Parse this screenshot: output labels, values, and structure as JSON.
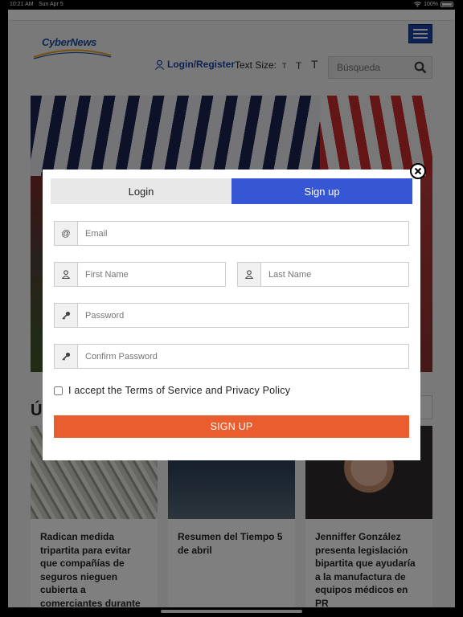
{
  "status_bar": {
    "time": "10:21 AM",
    "date": "Sun Apr 5",
    "battery": "100%"
  },
  "header": {
    "logo_text": "CyberNews",
    "login_label": "Login/Register",
    "text_size_label": "Text Size:",
    "text_size_options": [
      "T",
      "T",
      "T"
    ],
    "search_placeholder": "Búsqueda"
  },
  "section": {
    "title": "Ú"
  },
  "cards": [
    {
      "title": "Radican medida tripartita para evitar que compañías de seguros nieguen cubierta a comerciantes durante"
    },
    {
      "title": "Resumen del Tiempo 5 de abril"
    },
    {
      "title": "Jenniffer González presenta legislación bipartita que ayudaría a la manufactura de equipos médicos en PR"
    }
  ],
  "modal": {
    "tabs": {
      "login": "Login",
      "signup": "Sign up"
    },
    "email_addon": "@",
    "email_placeholder": "Email",
    "first_name_placeholder": "First Name",
    "last_name_placeholder": "Last Name",
    "password_placeholder": "Password",
    "confirm_password_placeholder": "Confirm Password",
    "terms_label": "I accept the Terms of Service and Privacy Policy",
    "submit_label": "SIGN UP"
  },
  "colors": {
    "brand_blue": "#1c43a8",
    "tab_active": "#3656d4",
    "submit_orange": "#ea5d2e"
  }
}
